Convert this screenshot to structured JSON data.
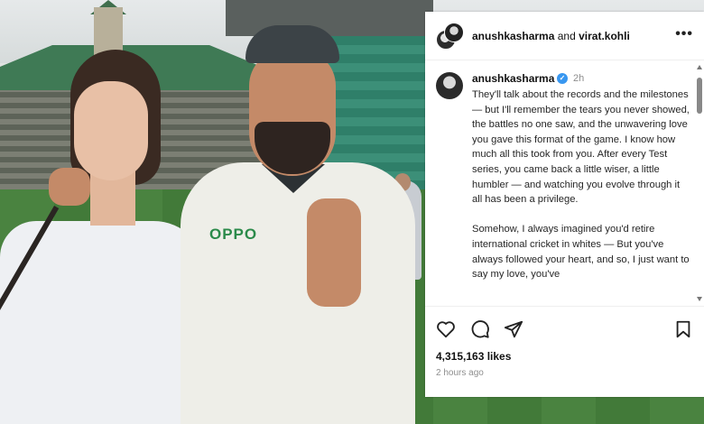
{
  "post": {
    "header": {
      "user1": "anushkasharma",
      "connector": "and",
      "user2": "virat.kohli",
      "more_icon": "more-horizontal-icon"
    },
    "caption": {
      "username": "anushkasharma",
      "verified_icon": "verified-badge-icon",
      "time": "2h",
      "paragraphs": [
        "They'll talk about the records and the milestones — but I'll remember the tears you never showed, the battles no one saw, and the unwavering love you gave this format of the game. I know how much all this took from you. After every Test series, you came back a little wiser, a little humbler — and watching you evolve through it all has been a privilege.",
        "Somehow, I always imagined you'd retire international cricket in whites — But you've always followed your heart, and so, I just want to say my love, you've"
      ]
    },
    "actions": {
      "like_icon": "heart-icon",
      "comment_icon": "comment-icon",
      "share_icon": "send-icon",
      "save_icon": "bookmark-icon"
    },
    "likes": "4,315,163 likes",
    "timestamp": "2 hours ago"
  },
  "photo": {
    "jersey_text": "OPPO"
  }
}
